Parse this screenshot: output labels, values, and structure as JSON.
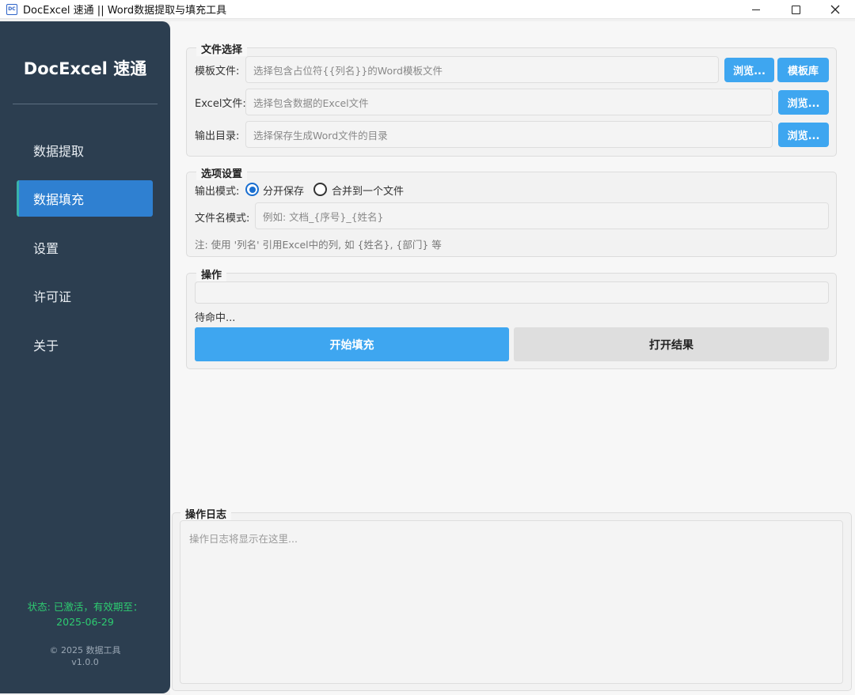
{
  "window": {
    "title": "DocExcel 速通 || Word数据提取与填充工具",
    "icon_text": "DC"
  },
  "sidebar": {
    "brand": "DocExcel 速通",
    "items": [
      {
        "label": "数据提取",
        "active": false
      },
      {
        "label": "数据填充",
        "active": true
      },
      {
        "label": "设置",
        "active": false
      },
      {
        "label": "许可证",
        "active": false
      },
      {
        "label": "关于",
        "active": false
      }
    ],
    "status_line1": "状态: 已激活，有效期至：",
    "status_line2": "2025-06-29",
    "copyright": "© 2025 数据工具",
    "version": "v1.0.0"
  },
  "file_select": {
    "title": "文件选择",
    "template_label": "模板文件:",
    "template_placeholder": "选择包含占位符{{列名}}的Word模板文件",
    "excel_label": "Excel文件:",
    "excel_placeholder": "选择包含数据的Excel文件",
    "output_label": "输出目录:",
    "output_placeholder": "选择保存生成Word文件的目录",
    "browse_label": "浏览...",
    "template_lib_label": "模板库"
  },
  "options": {
    "title": "选项设置",
    "output_mode_label": "输出模式:",
    "mode_separate": "分开保存",
    "mode_merge": "合并到一个文件",
    "selected_mode": "分开保存",
    "filename_label": "文件名模式:",
    "filename_placeholder": "例如: 文档_{序号}_{姓名}",
    "note": "注: 使用 '列名' 引用Excel中的列, 如 {姓名}, {部门} 等"
  },
  "actions": {
    "title": "操作",
    "progress": 0,
    "status": "待命中...",
    "start_label": "开始填充",
    "open_label": "打开结果"
  },
  "log": {
    "title": "操作日志",
    "placeholder": "操作日志将显示在这里..."
  },
  "colors": {
    "sidebar_bg": "#2c3e50",
    "active_nav": "#2f80d1",
    "accent_blue": "#3ea6f0",
    "status_green": "#2ecc71"
  }
}
